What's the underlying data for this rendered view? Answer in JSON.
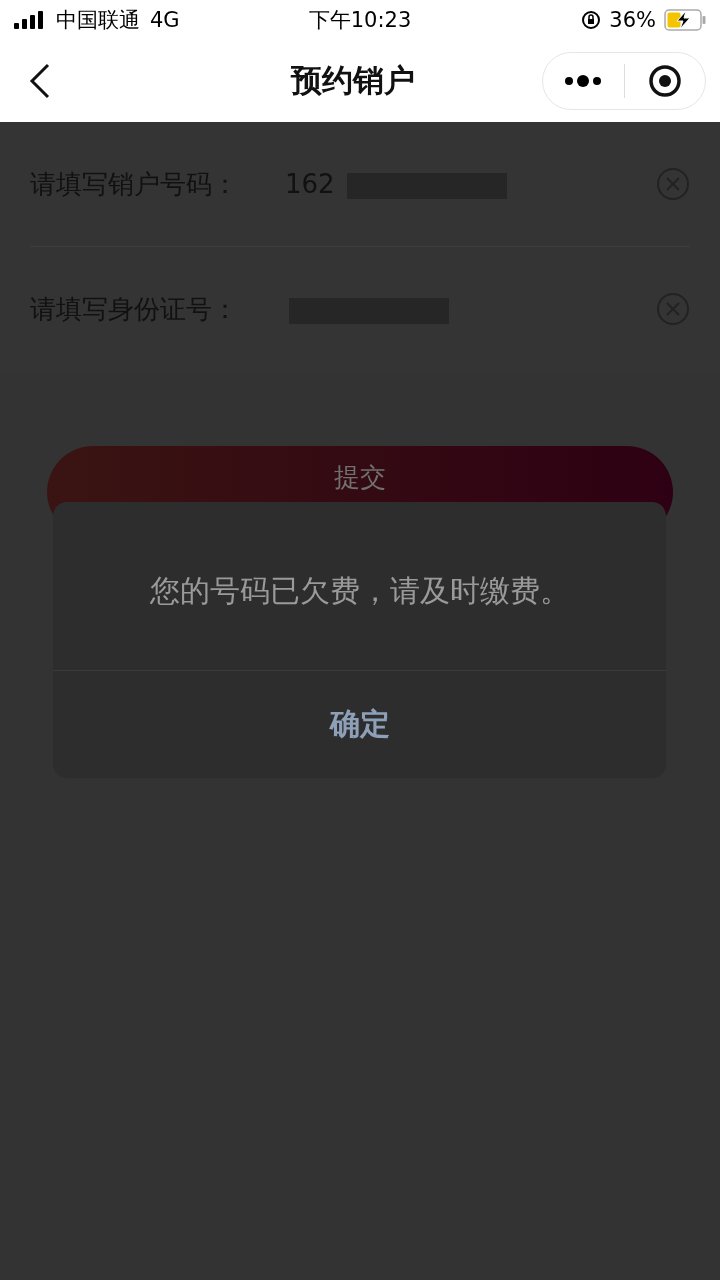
{
  "status_bar": {
    "carrier": "中国联通",
    "network": "4G",
    "time": "下午10:23",
    "battery": "36%"
  },
  "nav": {
    "title": "预约销户"
  },
  "form": {
    "fields": [
      {
        "label": "请填写销户号码：",
        "value": "162"
      },
      {
        "label": "请填写身份证号："
      }
    ]
  },
  "submit_button": "提交",
  "dialog": {
    "message": "您的号码已欠费，请及时缴费。",
    "button": "确定"
  }
}
